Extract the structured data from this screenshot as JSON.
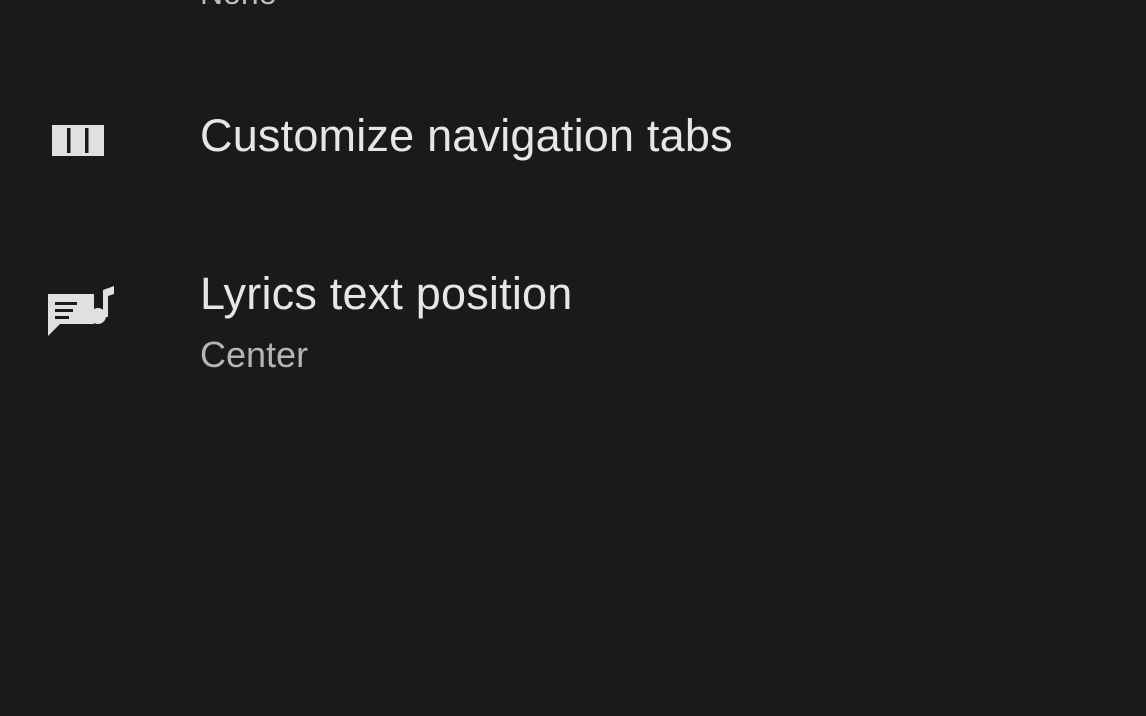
{
  "settings": {
    "clipped_item": {
      "value": "None"
    },
    "items": [
      {
        "title": "Customize navigation tabs",
        "icon": "view-columns-icon"
      },
      {
        "title": "Lyrics text position",
        "subtitle": "Center",
        "icon": "lyrics-icon"
      }
    ]
  },
  "colors": {
    "background": "#1a1a1a",
    "title": "#e6e6e6",
    "subtitle": "#b5b5b5",
    "icon": "#e0e0e0"
  }
}
